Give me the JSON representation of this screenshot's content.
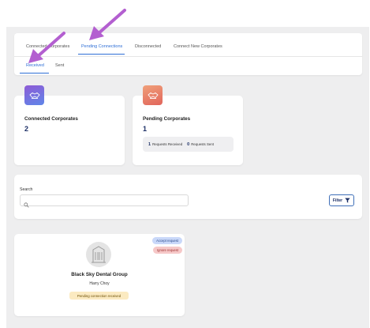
{
  "tabs": {
    "primary": [
      {
        "label": "Connected Corporates"
      },
      {
        "label": "Pending Connections",
        "active": true
      },
      {
        "label": "Disconnected"
      },
      {
        "label": "Connect New Corporates"
      }
    ],
    "secondary": [
      {
        "label": "Received",
        "active": true
      },
      {
        "label": "Sent"
      }
    ],
    "accent_color": "#2f6fd6"
  },
  "stats": {
    "connected": {
      "title": "Connected Corporates",
      "value": "2",
      "icon": "handshake-icon",
      "icon_color": "#7a6fe0"
    },
    "pending": {
      "title": "Pending Corporates",
      "value": "1",
      "icon": "handshake-icon",
      "icon_color": "#e8786a",
      "requests_received_count": "1",
      "requests_received_label": "Requests Received",
      "requests_sent_count": "0",
      "requests_sent_label": "Requests Sent"
    }
  },
  "search": {
    "label": "Search",
    "placeholder": "",
    "filter_label": "Filter"
  },
  "connection": {
    "company": "Black Sky Dental Group",
    "person": "Harry Choy",
    "accept_label": "Accept request",
    "ignore_label": "Ignore request",
    "status": "Pending connection received",
    "avatar_icon": "building-icon"
  },
  "annotations": {
    "arrow_color": "#b35fd0"
  }
}
